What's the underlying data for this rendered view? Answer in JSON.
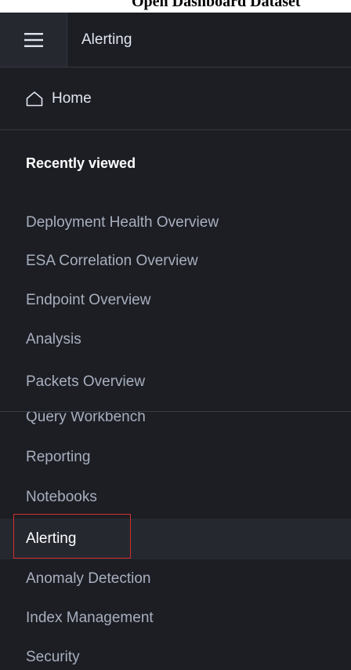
{
  "top_strip_text": "Open Dashboard Dataset",
  "header": {
    "menu_icon": "menu-icon",
    "title": "Alerting"
  },
  "home": {
    "icon": "home-icon",
    "label": "Home"
  },
  "recently_viewed": {
    "title": "Recently viewed",
    "items": [
      {
        "label": "Deployment Health Overview"
      },
      {
        "label": "ESA Correlation Overview"
      },
      {
        "label": "Endpoint Overview"
      },
      {
        "label": "Analysis"
      },
      {
        "label": "Packets Overview"
      }
    ]
  },
  "plugins": {
    "items": [
      {
        "label": "Query Workbench"
      },
      {
        "label": "Reporting"
      },
      {
        "label": "Notebooks"
      },
      {
        "label": "Alerting",
        "active": true
      },
      {
        "label": "Anomaly Detection"
      },
      {
        "label": "Index Management"
      },
      {
        "label": "Security"
      }
    ]
  },
  "colors": {
    "background": "#1d1e24",
    "active_background": "#25282f",
    "highlight": "#d32f2f",
    "muted_text": "#a7afbe"
  }
}
